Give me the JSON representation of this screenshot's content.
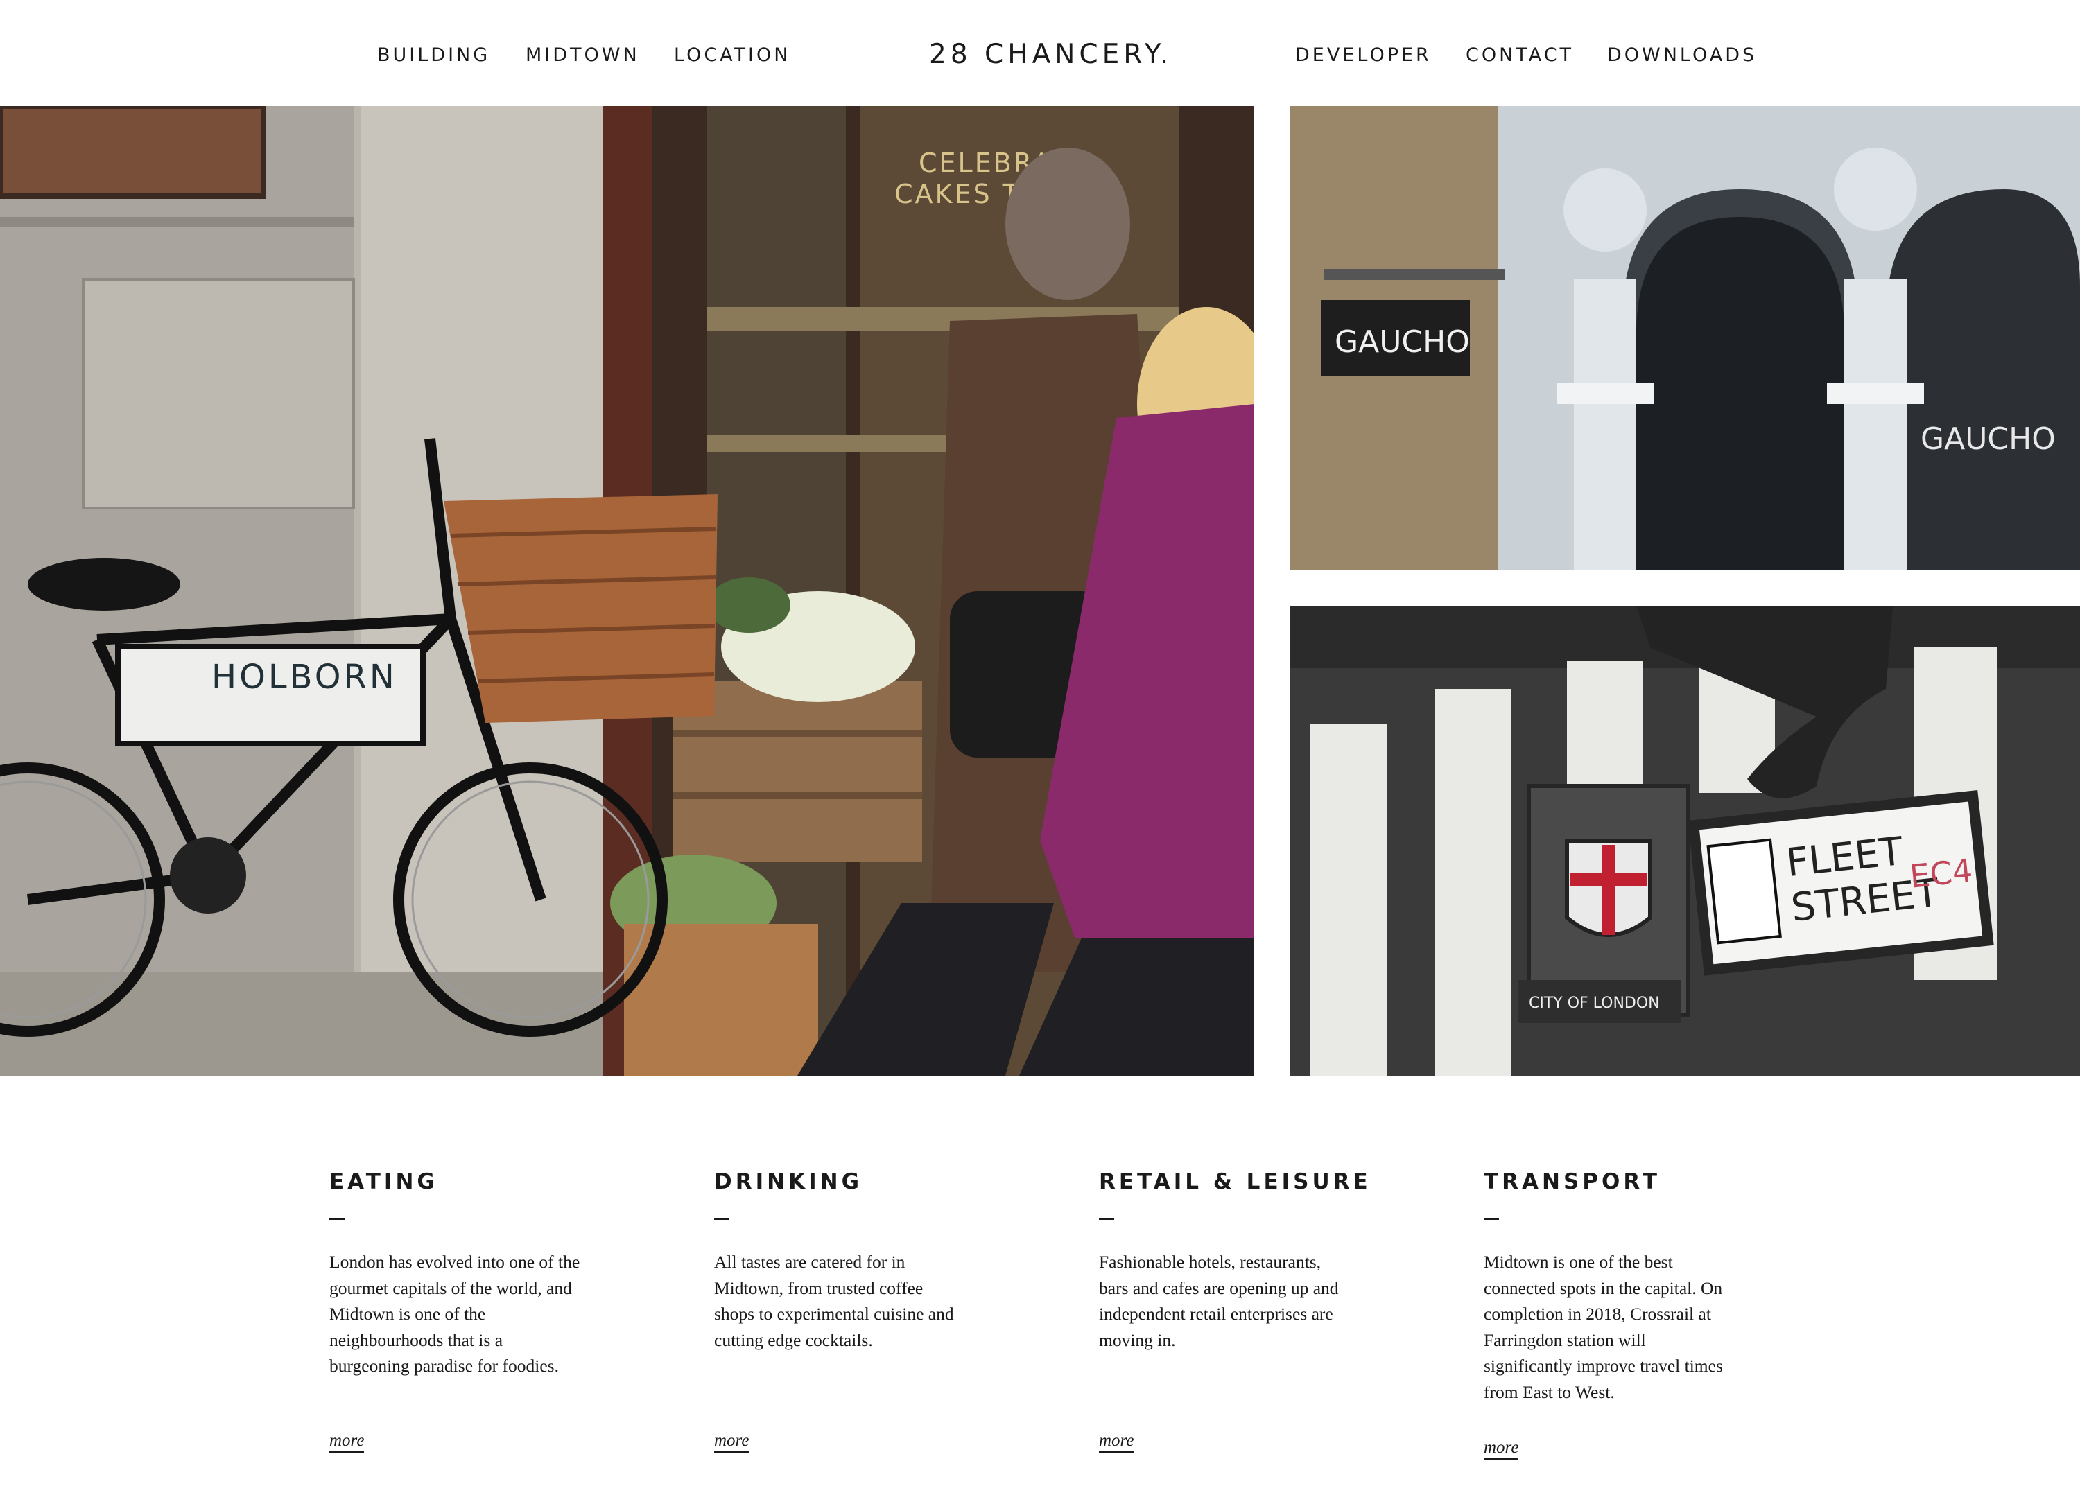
{
  "nav": {
    "left": [
      {
        "label": "BUILDING"
      },
      {
        "label": "MIDTOWN"
      },
      {
        "label": "LOCATION"
      }
    ],
    "logo": "28 CHANCERY.",
    "right": [
      {
        "label": "DEVELOPER"
      },
      {
        "label": "CONTACT"
      },
      {
        "label": "DOWNLOADS"
      }
    ]
  },
  "photos": {
    "main": {
      "bike_sign": "HOLBORN",
      "shop_sign_line1": "CELEBRAT",
      "shop_sign_line2": "CAKES TO"
    },
    "top_right": {
      "hanging_sign": "GAUCHO",
      "window_text": "GAUCHO"
    },
    "bottom_right": {
      "street_sign_line1": "FLEET",
      "street_sign_line2": "STREET",
      "postcode": "EC4",
      "crest_plaque": "CITY OF LONDON"
    }
  },
  "sections": [
    {
      "title": "EATING",
      "lines": [
        "London has evolved into one of the",
        "gourmet capitals of the world, and",
        "Midtown is one of the",
        "neighbourhoods that is a",
        "burgeoning paradise for foodies."
      ],
      "more": "more"
    },
    {
      "title": "DRINKING",
      "lines": [
        "All tastes are catered for in",
        "Midtown, from trusted coffee",
        "shops to experimental cuisine and",
        "cutting edge cocktails."
      ],
      "more": "more"
    },
    {
      "title": "RETAIL & LEISURE",
      "lines": [
        "Fashionable hotels, restaurants,",
        "bars and cafes are opening up and",
        "independent retail enterprises are",
        "moving in."
      ],
      "more": "more"
    },
    {
      "title": "TRANSPORT",
      "lines": [
        "Midtown is one of the best",
        "connected spots in the capital. On",
        "completion in 2018, Crossrail at",
        "Farringdon station will",
        "significantly improve travel times",
        "from East to West."
      ],
      "more": "more"
    }
  ],
  "colors": {
    "text": "#1a1a1a",
    "background": "#ffffff",
    "coat_magenta": "#8a2a6a",
    "coat_brown": "#5a4030",
    "basket": "#a8653a",
    "postcode_red": "#c0485a"
  }
}
